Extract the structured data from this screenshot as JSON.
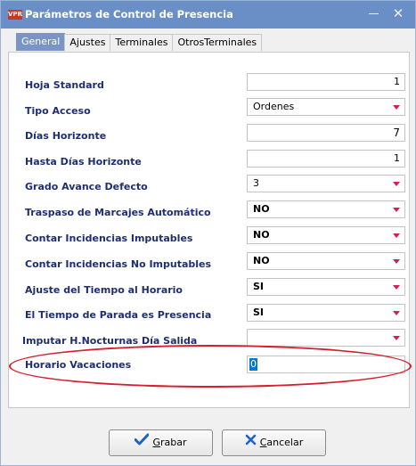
{
  "window": {
    "icon_text": "VPR",
    "title": "Parámetros de Control de Presencia",
    "close_glyph": "✕"
  },
  "tabs": [
    {
      "label": "General",
      "active": true
    },
    {
      "label": "Ajustes",
      "active": false
    },
    {
      "label": "Terminales",
      "active": false
    },
    {
      "label": "OtrosTerminales",
      "active": false
    }
  ],
  "fields": {
    "hoja_standard": {
      "label": "Hoja Standard",
      "value": "1"
    },
    "tipo_acceso": {
      "label": "Tipo Acceso",
      "value": "Ordenes"
    },
    "dias_horizonte": {
      "label": "Días Horizonte",
      "value": "7"
    },
    "hasta_dias_horizonte": {
      "label": "Hasta Días Horizonte",
      "value": "1"
    },
    "grado_avance_defecto": {
      "label": "Grado Avance Defecto",
      "value": "3"
    },
    "traspaso_marcajes": {
      "label": "Traspaso de Marcajes Automático",
      "value": "NO"
    },
    "contar_imputables": {
      "label": "Contar Incidencias Imputables",
      "value": "NO"
    },
    "contar_no_imputables": {
      "label": "Contar Incidencias No Imputables",
      "value": "NO"
    },
    "ajuste_tiempo": {
      "label": "Ajuste del Tiempo al Horario",
      "value": "SI"
    },
    "tiempo_parada": {
      "label": "El Tiempo de Parada es Presencia",
      "value": "SI"
    },
    "imputar_nocturnas": {
      "label": "Imputar H.Nocturnas Día Salida",
      "value": ""
    },
    "horario_vacaciones": {
      "label": "Horario Vacaciones",
      "value": "0"
    }
  },
  "buttons": {
    "grabar": {
      "accel": "G",
      "rest": "rabar",
      "icon": "checkmark-icon"
    },
    "cancelar": {
      "accel": "C",
      "rest": "ancelar",
      "icon": "x-icon"
    }
  },
  "colors": {
    "titlebar": "#6a8fc7",
    "label": "#1e2e73",
    "dropdown_arrow": "#d81b60",
    "highlight": "#d61f2c",
    "selection": "#0078d7"
  }
}
